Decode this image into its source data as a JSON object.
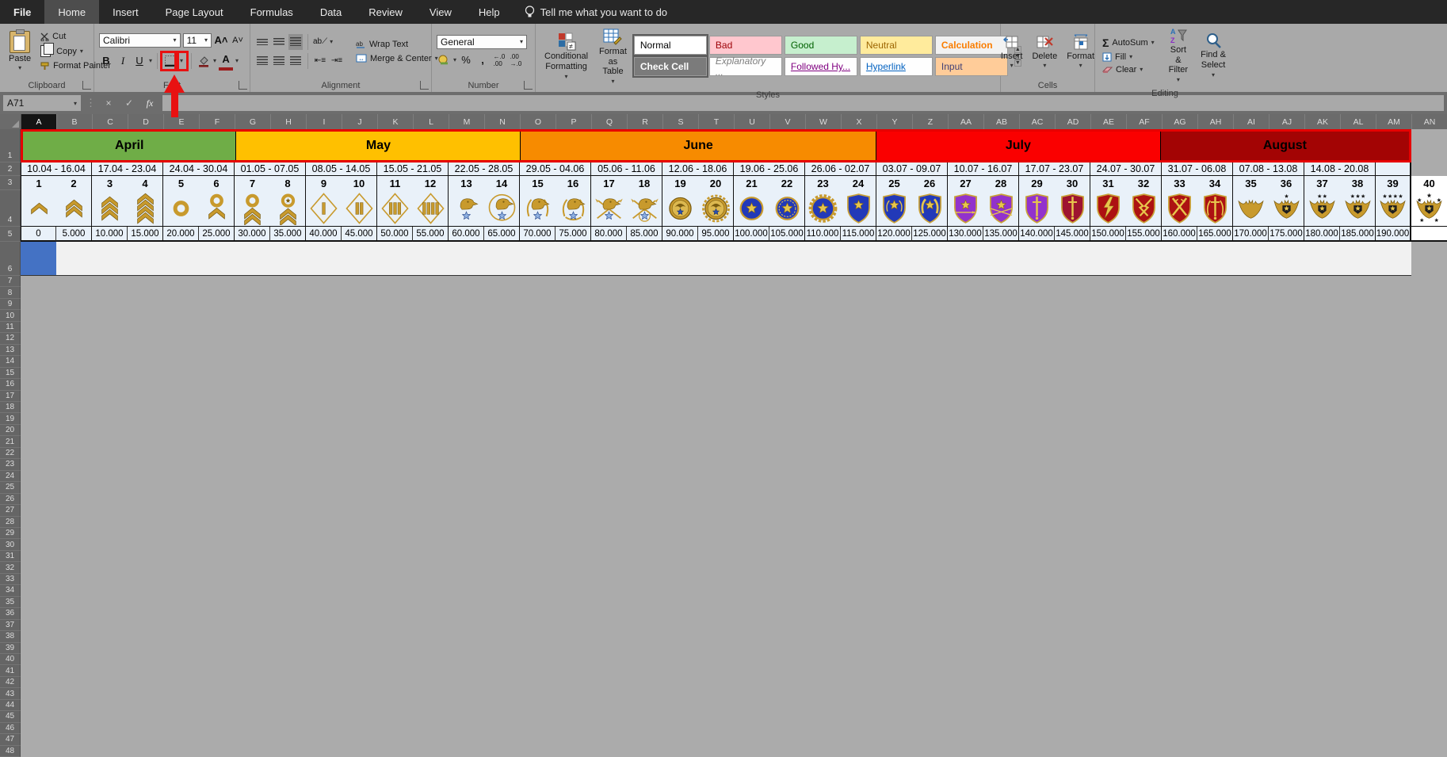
{
  "ribbon": {
    "tabs": [
      "File",
      "Home",
      "Insert",
      "Page Layout",
      "Formulas",
      "Data",
      "Review",
      "View",
      "Help"
    ],
    "active_tab": "Home",
    "tell_me": "Tell me what you want to do",
    "clipboard": {
      "group": "Clipboard",
      "paste": "Paste",
      "cut": "Cut",
      "copy": "Copy",
      "format_painter": "Format Painter"
    },
    "font": {
      "group": "Font",
      "family": "Calibri",
      "size": "11",
      "bold": "B",
      "italic": "I",
      "underline": "U"
    },
    "alignment": {
      "group": "Alignment",
      "wrap_text": "Wrap Text",
      "merge_center": "Merge & Center"
    },
    "number": {
      "group": "Number",
      "format": "General",
      "percent": "%",
      "comma": ","
    },
    "styles": {
      "group": "Styles",
      "conditional_formatting": "Conditional Formatting",
      "format_as_table": "Format as Table",
      "chips": [
        {
          "label": "Normal",
          "bg": "#ffffff",
          "fg": "#000000",
          "boxed": true
        },
        {
          "label": "Bad",
          "bg": "#ffc7ce",
          "fg": "#9c0006"
        },
        {
          "label": "Good",
          "bg": "#c6efce",
          "fg": "#006100"
        },
        {
          "label": "Neutral",
          "bg": "#ffeb9c",
          "fg": "#9c6500"
        },
        {
          "label": "Calculation",
          "bg": "#f2f2f2",
          "fg": "#fa7d00",
          "bold": true
        },
        {
          "label": "Check Cell",
          "bg": "#7b7b7b",
          "fg": "#ffffff",
          "bold": true,
          "boxed": true
        },
        {
          "label": "Explanatory ...",
          "bg": "#fefefe",
          "fg": "#7f7f7f",
          "italic": true
        },
        {
          "label": "Followed Hy...",
          "bg": "#fefefe",
          "fg": "#800080",
          "underline": true
        },
        {
          "label": "Hyperlink",
          "bg": "#fefefe",
          "fg": "#0563c1",
          "underline": true
        },
        {
          "label": "Input",
          "bg": "#ffcc99",
          "fg": "#3f3f76"
        }
      ]
    },
    "cells": {
      "group": "Cells",
      "insert": "Insert",
      "delete": "Delete",
      "format": "Format"
    },
    "editing": {
      "group": "Editing",
      "autosum": "AutoSum",
      "fill": "Fill",
      "clear": "Clear",
      "sort_filter": "Sort & Filter",
      "find_select": "Find & Select",
      "sigma": "Σ"
    }
  },
  "formula_bar": {
    "name_box": "A71",
    "formula": "",
    "fx": "fx"
  },
  "annotation": {
    "target": "borders-button",
    "box_color": "#e81111",
    "arrow_color": "#e81111"
  },
  "sheet": {
    "selected_column": "A",
    "selected_cell_row": 6,
    "colors": {
      "cell_bg": "#e9f1f9",
      "row6_bg": "#f1f1f1",
      "selected_cell_fill": "#4472c4",
      "canvas": "#ababab",
      "table_frame": "#e60000"
    },
    "columns": [
      "A",
      "B",
      "C",
      "D",
      "E",
      "F",
      "G",
      "H",
      "I",
      "J",
      "K",
      "L",
      "M",
      "N",
      "O",
      "P",
      "Q",
      "R",
      "S",
      "T",
      "U",
      "V",
      "W",
      "X",
      "Y",
      "Z",
      "AA",
      "AB",
      "AC",
      "AD",
      "AE",
      "AF",
      "AG",
      "AH",
      "AI",
      "AJ",
      "AK",
      "AL",
      "AM",
      "AN"
    ],
    "months": [
      {
        "label": "April",
        "cols": 6,
        "bg": "#6fad47"
      },
      {
        "label": "May",
        "cols": 8,
        "bg": "#ffc000"
      },
      {
        "label": "June",
        "cols": 10,
        "bg": "#f78b00"
      },
      {
        "label": "July",
        "cols": 8,
        "bg": "#fa0000"
      },
      {
        "label": "August",
        "cols": 7,
        "bg": "#a30404"
      }
    ],
    "date_ranges": [
      "10.04 - 16.04",
      "17.04 - 23.04",
      "24.04 - 30.04",
      "01.05 - 07.05",
      "08.05 - 14.05",
      "15.05 - 21.05",
      "22.05 - 28.05",
      "29.05 - 04.06",
      "05.06 - 11.06",
      "12.06 - 18.06",
      "19.06 - 25.06",
      "26.06 - 02.07",
      "03.07 - 09.07",
      "10.07 - 16.07",
      "17.07 - 23.07",
      "24.07 - 30.07",
      "31.07 - 06.08",
      "07.08 - 13.08",
      "14.08 - 20.08"
    ],
    "ranks": [
      {
        "n": "1",
        "name": "rank-1-chevron-1",
        "kind": "chevron",
        "p": "1",
        "value": "0"
      },
      {
        "n": "2",
        "name": "rank-2-chevron-2",
        "kind": "chevron",
        "p": "2",
        "value": "5.000"
      },
      {
        "n": "3",
        "name": "rank-3-chevron-3",
        "kind": "chevron",
        "p": "3",
        "value": "10.000"
      },
      {
        "n": "4",
        "name": "rank-4-chevron-4",
        "kind": "chevron",
        "p": "4",
        "value": "15.000"
      },
      {
        "n": "5",
        "name": "rank-5-gold-ring",
        "kind": "ring",
        "p": "0",
        "value": "20.000"
      },
      {
        "n": "6",
        "name": "rank-6-ring-chevron",
        "kind": "ring",
        "p": "1",
        "value": "25.000"
      },
      {
        "n": "7",
        "name": "rank-7-ring-chevrons",
        "kind": "ring",
        "p": "2",
        "value": "30.000"
      },
      {
        "n": "8",
        "name": "rank-8-ring-star-chevrons",
        "kind": "ringstar",
        "p": "2",
        "value": "35.000"
      },
      {
        "n": "9",
        "name": "rank-9-diamond-1-bar",
        "kind": "diamond",
        "p": "1",
        "value": "40.000"
      },
      {
        "n": "10",
        "name": "rank-10-diamond-2-bars",
        "kind": "diamond",
        "p": "2",
        "value": "45.000"
      },
      {
        "n": "11",
        "name": "rank-11-diamond-3-bars",
        "kind": "diamond",
        "p": "3",
        "value": "50.000"
      },
      {
        "n": "12",
        "name": "rank-12-diamond-4-bars",
        "kind": "diamond",
        "p": "4",
        "value": "55.000"
      },
      {
        "n": "13",
        "name": "rank-13-eagle-star",
        "kind": "eaglehead",
        "p": "plain",
        "value": "60.000"
      },
      {
        "n": "14",
        "name": "rank-14-eagle-circle",
        "kind": "eaglehead",
        "p": "circle",
        "value": "65.000"
      },
      {
        "n": "15",
        "name": "rank-15-eagle-halfwreath",
        "kind": "eaglehead",
        "p": "halfwreath",
        "value": "70.000"
      },
      {
        "n": "16",
        "name": "rank-16-eagle-wreath",
        "kind": "eaglehead",
        "p": "wreath",
        "value": "75.000"
      },
      {
        "n": "17",
        "name": "rank-17-eagle-arrows",
        "kind": "eaglehead",
        "p": "arrows",
        "value": "80.000"
      },
      {
        "n": "18",
        "name": "rank-18-eagle-arrows-ring",
        "kind": "eaglehead",
        "p": "arrowsring",
        "value": "85.000"
      },
      {
        "n": "19",
        "name": "rank-19-gold-medal",
        "kind": "medal",
        "p": "plain",
        "value": "90.000"
      },
      {
        "n": "20",
        "name": "rank-20-medal-wreath",
        "kind": "medal",
        "p": "wreath",
        "value": "95.000"
      },
      {
        "n": "21",
        "name": "rank-21-blue-disc-star",
        "kind": "disc",
        "p": "0",
        "value": "100.000"
      },
      {
        "n": "22",
        "name": "rank-22-disc-inner-wreath",
        "kind": "disc",
        "p": "1",
        "value": "105.000"
      },
      {
        "n": "23",
        "name": "rank-23-disc-gold-wreath",
        "kind": "disc",
        "p": "2",
        "value": "110.000"
      },
      {
        "n": "24",
        "name": "rank-24-blue-shield-star",
        "kind": "shield",
        "p": "blue-star",
        "value": "115.000"
      },
      {
        "n": "25",
        "name": "rank-25-blue-shield-wreath",
        "kind": "shield",
        "p": "blue-wreath",
        "value": "120.000"
      },
      {
        "n": "26",
        "name": "rank-26-blue-shield-gold",
        "kind": "shield",
        "p": "blue-gold",
        "value": "125.000"
      },
      {
        "n": "27",
        "name": "rank-27-purple-shield-arrow",
        "kind": "shield",
        "p": "purple-arrow",
        "value": "130.000"
      },
      {
        "n": "28",
        "name": "rank-28-purple-shield-arrows",
        "kind": "shield",
        "p": "purple-arrows",
        "value": "135.000"
      },
      {
        "n": "29",
        "name": "rank-29-purple-shield-sword",
        "kind": "shield",
        "p": "purple-sword",
        "value": "140.000"
      },
      {
        "n": "30",
        "name": "rank-30-crimson-shield-sword",
        "kind": "shield",
        "p": "crimson-sword",
        "value": "145.000"
      },
      {
        "n": "31",
        "name": "rank-31-red-shield-bolt",
        "kind": "shield",
        "p": "red-bolt",
        "value": "150.000"
      },
      {
        "n": "32",
        "name": "rank-32-red-shield-bolts",
        "kind": "shield",
        "p": "red-bolts",
        "value": "155.000"
      },
      {
        "n": "33",
        "name": "rank-33-red-shield-swords",
        "kind": "shield",
        "p": "red-swords",
        "value": "160.000"
      },
      {
        "n": "34",
        "name": "rank-34-red-sword-wreath",
        "kind": "shield",
        "p": "red-sword-wreath",
        "value": "165.000"
      },
      {
        "n": "35",
        "name": "rank-35-gold-eagle",
        "kind": "eagle",
        "p": "0",
        "value": "170.000"
      },
      {
        "n": "36",
        "name": "rank-36-eagle-1-star",
        "kind": "eagle",
        "p": "1",
        "value": "175.000"
      },
      {
        "n": "37",
        "name": "rank-37-eagle-2-stars",
        "kind": "eagle",
        "p": "2",
        "value": "180.000"
      },
      {
        "n": "38",
        "name": "rank-38-eagle-3-stars",
        "kind": "eagle",
        "p": "3",
        "value": "185.000"
      },
      {
        "n": "39",
        "name": "rank-39-eagle-4-stars",
        "kind": "eagle",
        "p": "4",
        "value": "190.000"
      },
      {
        "n": "40",
        "name": "rank-40-grand-eagle",
        "kind": "eagle",
        "p": "5",
        "value": ""
      }
    ],
    "filler_rows": {
      "from": 7,
      "to": 48
    }
  }
}
